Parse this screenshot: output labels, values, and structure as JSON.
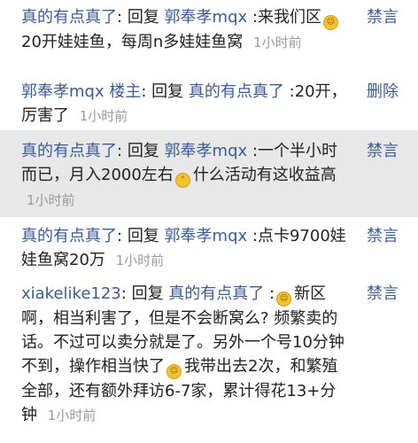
{
  "replies": [
    {
      "author": "真的有点真了",
      "sep": ":",
      "reply_word": "回复",
      "target": "郭奉孝mqx",
      "text_before": ":来我们区",
      "emoji": "smile-emoji",
      "text_after": "20开娃娃鱼，每周n多娃娃鱼窝",
      "time": "1小时前",
      "action": "禁言"
    },
    {
      "author": "郭奉孝mqx",
      "badge": "楼主",
      "sep": ":",
      "reply_word": "回复",
      "target": "真的有点真了",
      "text": ":20开，厉害了",
      "time": "1小时前",
      "action": "删除"
    },
    {
      "author": "真的有点真了",
      "sep": ":",
      "reply_word": "回复",
      "target": "郭奉孝mqx",
      "text_before": ":一个半小时而已，月入2000左右",
      "emoji": "surprised-emoji",
      "text_after": "什么活动有这收益高",
      "time": "1小时前",
      "action": "禁言"
    },
    {
      "author": "真的有点真了",
      "sep": ":",
      "reply_word": "回复",
      "target": "郭奉孝mqx",
      "text": ":点卡9700娃娃鱼窝20万",
      "time": "1小时前",
      "action": "禁言"
    },
    {
      "author": "xiakelike123",
      "sep": ":",
      "reply_word": "回复",
      "target": "真的有点真了",
      "text_before": ":",
      "emoji": "grin-emoji",
      "text_mid": "新区啊，相当利害了，但是不会断窝么? 频繁卖的话。不过可以卖分就是了。另外一个号10分钟不到，操作相当快了",
      "emoji2": "laugh-cry-emoji",
      "text_after": "我带出去2次，和繁殖全部，还有额外拜访6-7家，累计得花13+分钟",
      "time": "1小时前",
      "action": "禁言"
    }
  ],
  "colors": {
    "link": "#3b5b95",
    "time": "#9a9a9a",
    "highlight_bg": "#e8e8e8"
  }
}
